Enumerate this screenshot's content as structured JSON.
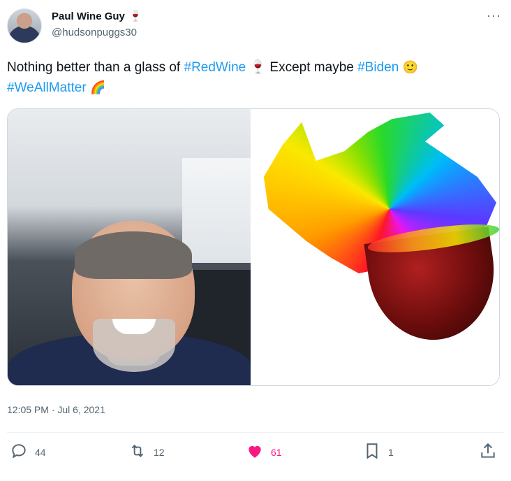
{
  "user": {
    "display_name": "Paul Wine Guy",
    "name_emoji": "🍷",
    "handle": "@hudsonpuggs30"
  },
  "tweet": {
    "text_before": "Nothing better than a glass of ",
    "hashtag_1": "#RedWine",
    "text_middle": " 🍷 Except maybe ",
    "hashtag_2": "#Biden",
    "emoji_1": "🙂",
    "hashtag_3": "#WeAllMatter",
    "emoji_2": "🌈",
    "timestamp": "12:05 PM · Jul 6, 2021"
  },
  "media": {
    "left_alt": "selfie",
    "right_alt": "wine glass splash"
  },
  "actions": {
    "reply_count": "44",
    "retweet_count": "12",
    "like_count": "61",
    "bookmark_count": "1"
  },
  "colors": {
    "link": "#1d9bf0",
    "like": "#f91880",
    "muted": "#536471"
  },
  "icons": [
    "more-icon",
    "reply-icon",
    "retweet-icon",
    "heart-icon",
    "bookmark-icon",
    "share-icon"
  ]
}
